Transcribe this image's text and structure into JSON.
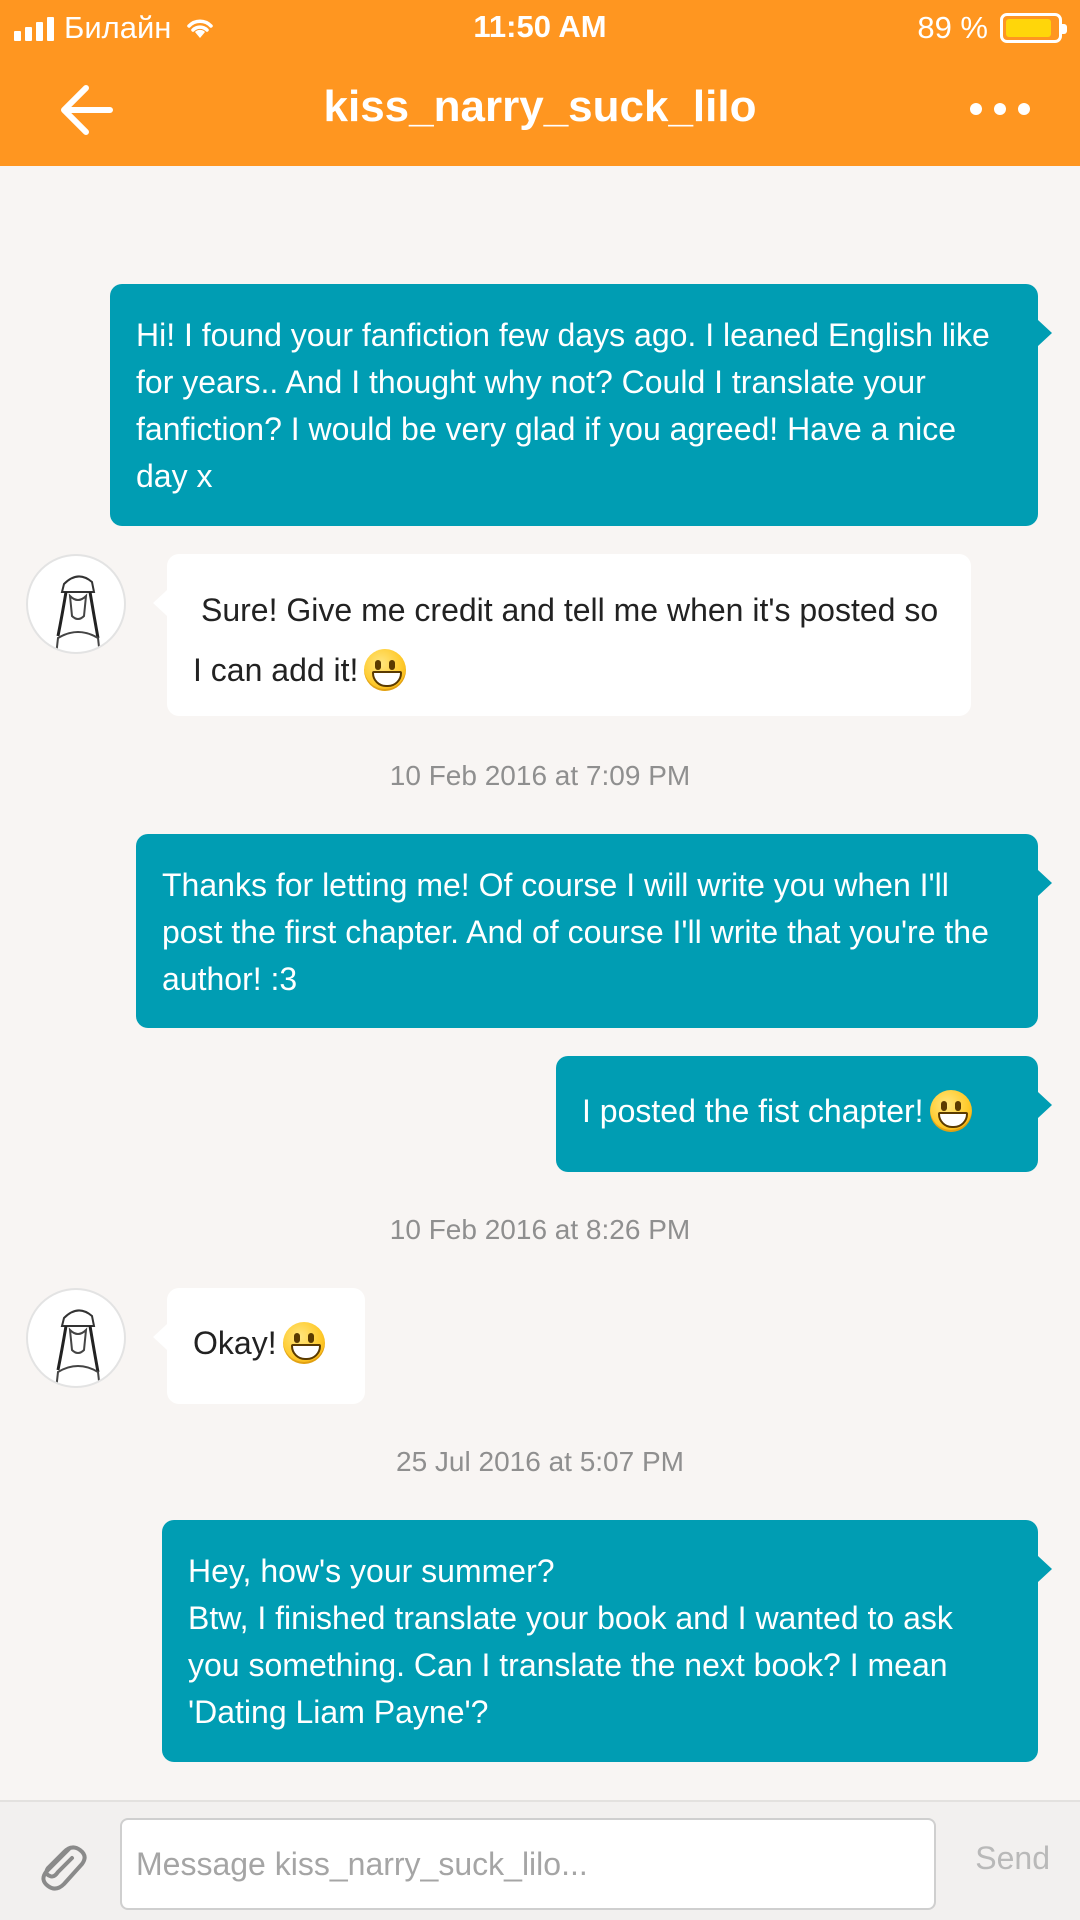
{
  "status_bar": {
    "carrier": "Билайн",
    "time": "11:50 AM",
    "battery_percent": "89 %",
    "battery_level": 0.89
  },
  "header": {
    "title": "kiss_narry_suck_lilo",
    "back_icon": "arrow-left-icon",
    "more_icon": "more-horizontal-icon",
    "color": "#ff9620"
  },
  "messages": [
    {
      "direction": "out",
      "text": "Hi! I found your fanfiction few days ago. I leaned English like for years.. And I thought why not? Could I translate your fanfiction? I would be very glad if you agreed! Have a nice day x"
    },
    {
      "direction": "in",
      "text": "Sure! Give me credit and tell me when it's posted so I can add it!",
      "emoji": "grinning-face"
    },
    {
      "type": "timestamp",
      "text": "10 Feb 2016 at 7:09 PM"
    },
    {
      "direction": "out",
      "text": "Thanks for letting me! Of course I will write you when I'll post the first chapter. And of course I'll write that you're the author! :3"
    },
    {
      "direction": "out",
      "text": "I posted the fist chapter!",
      "emoji": "grinning-face"
    },
    {
      "type": "timestamp",
      "text": "10 Feb 2016 at 8:26 PM"
    },
    {
      "direction": "in",
      "text": "Okay!",
      "emoji": "grinning-face"
    },
    {
      "type": "timestamp",
      "text": "25 Jul 2016 at 5:07 PM"
    },
    {
      "direction": "out",
      "text_line1": "Hey, how's your summer?",
      "text_line2": "Btw, I finished translate your book and I wanted to ask you something. Can I translate the next book? I mean 'Dating Liam Payne'?"
    }
  ],
  "colors": {
    "outgoing_bubble": "#009db3",
    "incoming_bubble": "#ffffff",
    "background": "#f8f5f3"
  },
  "composer": {
    "placeholder": "Message kiss_narry_suck_lilo...",
    "value": "",
    "send_label": "Send",
    "attach_icon": "paperclip-icon"
  }
}
